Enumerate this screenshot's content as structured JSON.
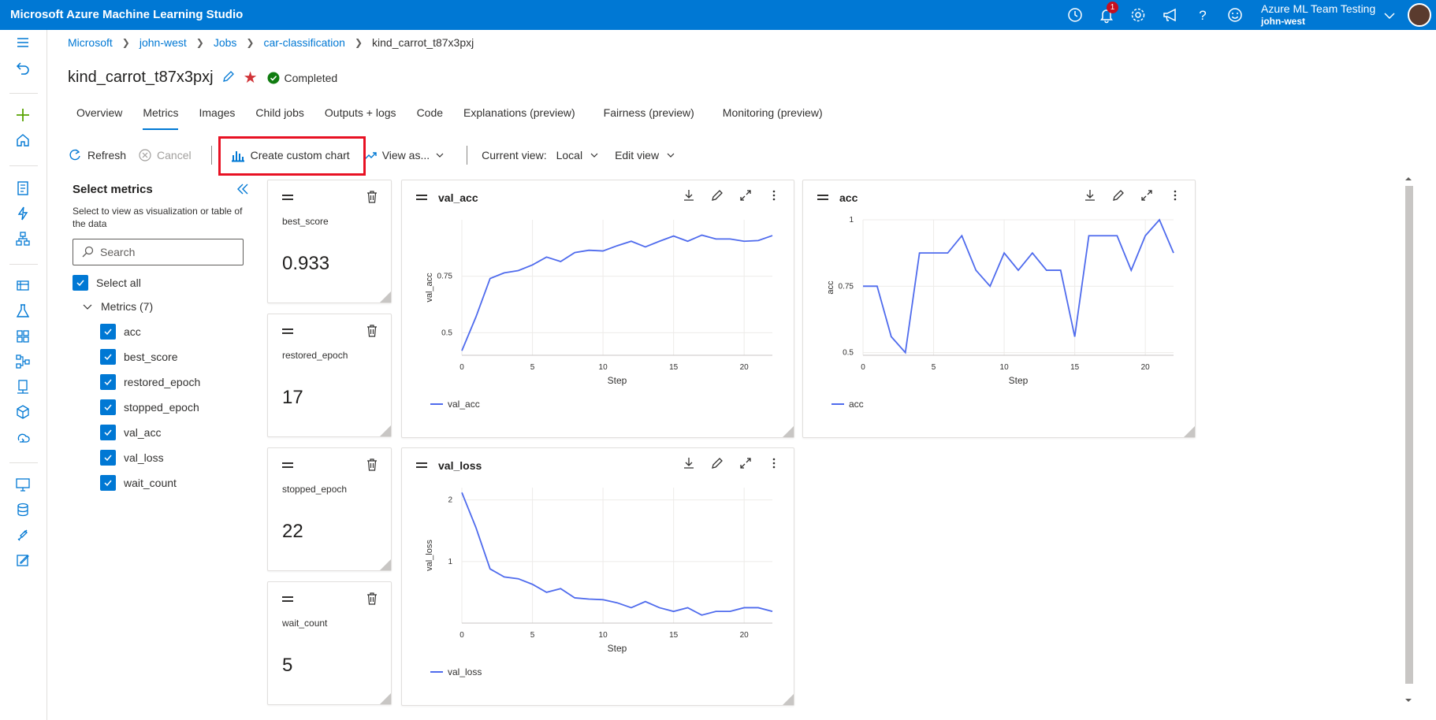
{
  "app": {
    "title": "Microsoft Azure Machine Learning Studio",
    "notification_count": "1",
    "account_name": "Azure ML Team Testing",
    "account_workspace": "john-west",
    "top_icons": [
      "clock-icon",
      "bell-icon",
      "gear-icon",
      "megaphone-icon",
      "help-icon",
      "smiley-icon"
    ]
  },
  "leftnav": {
    "icons": [
      "hamburger-icon",
      "back-icon",
      "plus-icon",
      "home-icon",
      "notebook-icon",
      "automl-icon",
      "designer-icon",
      "data-icon",
      "jobs-icon",
      "components-icon",
      "pipelines-icon",
      "environments-icon",
      "models-icon",
      "endpoints-icon",
      "compute-icon",
      "datastores-icon",
      "linked-services-icon",
      "labeling-icon"
    ]
  },
  "breadcrumb": [
    "Microsoft",
    "john-west",
    "Jobs",
    "car-classification",
    "kind_carrot_t87x3pxj"
  ],
  "run": {
    "name": "kind_carrot_t87x3pxj",
    "status": "Completed"
  },
  "tabs": [
    "Overview",
    "Metrics",
    "Images",
    "Child jobs",
    "Outputs + logs",
    "Code",
    "Explanations (preview)",
    "Fairness (preview)",
    "Monitoring (preview)"
  ],
  "active_tab": "Metrics",
  "toolbar": {
    "refresh": "Refresh",
    "cancel": "Cancel",
    "create_chart": "Create custom chart",
    "view_as": "View as...",
    "current_view_label": "Current view:",
    "current_view_value": "Local",
    "edit_view": "Edit view"
  },
  "panel": {
    "title": "Select metrics",
    "subtitle": "Select to view as visualization or table of the data",
    "search_placeholder": "Search",
    "select_all": "Select all",
    "group": "Metrics (7)",
    "metrics": [
      "acc",
      "best_score",
      "restored_epoch",
      "stopped_epoch",
      "val_acc",
      "val_loss",
      "wait_count"
    ]
  },
  "scalar_cards": [
    {
      "label": "best_score",
      "value": "0.933"
    },
    {
      "label": "restored_epoch",
      "value": "17"
    },
    {
      "label": "stopped_epoch",
      "value": "22"
    },
    {
      "label": "wait_count",
      "value": "5"
    }
  ],
  "colors": {
    "accent": "#0078d4",
    "series": "#4f6bed",
    "success": "#107c10",
    "star": "#d13438",
    "highlight": "#e81123"
  },
  "chart_data": [
    {
      "type": "line",
      "title": "val_acc",
      "xlabel": "Step",
      "ylabel": "val_acc",
      "x": [
        0,
        1,
        2,
        3,
        4,
        5,
        6,
        7,
        8,
        9,
        10,
        11,
        12,
        13,
        14,
        15,
        16,
        17,
        18,
        19,
        20,
        21,
        22
      ],
      "series": [
        {
          "name": "val_acc",
          "values": [
            0.42,
            0.57,
            0.74,
            0.765,
            0.775,
            0.8,
            0.835,
            0.815,
            0.855,
            0.865,
            0.862,
            0.885,
            0.905,
            0.88,
            0.905,
            0.928,
            0.905,
            0.932,
            0.915,
            0.915,
            0.905,
            0.908,
            0.93
          ]
        }
      ],
      "xticks": [
        0,
        5,
        10,
        15,
        20
      ],
      "yticks": [
        0.5,
        0.75
      ],
      "xlim": [
        0,
        22
      ],
      "ylim": [
        0.4,
        1.0
      ]
    },
    {
      "type": "line",
      "title": "acc",
      "xlabel": "Step",
      "ylabel": "acc",
      "x": [
        0,
        1,
        2,
        3,
        4,
        5,
        6,
        7,
        8,
        9,
        10,
        11,
        12,
        13,
        14,
        15,
        16,
        17,
        18,
        19,
        20,
        21,
        22
      ],
      "series": [
        {
          "name": "acc",
          "values": [
            0.75,
            0.75,
            0.56,
            0.5,
            0.875,
            0.875,
            0.875,
            0.94,
            0.81,
            0.75,
            0.875,
            0.81,
            0.875,
            0.81,
            0.81,
            0.56,
            0.94,
            0.94,
            0.94,
            0.81,
            0.94,
            1.0,
            0.875
          ]
        }
      ],
      "xticks": [
        0,
        5,
        10,
        15,
        20
      ],
      "yticks": [
        0.5,
        0.75,
        1
      ],
      "xlim": [
        0,
        22
      ],
      "ylim": [
        0.49,
        1.0
      ]
    },
    {
      "type": "line",
      "title": "val_loss",
      "xlabel": "Step",
      "ylabel": "val_loss",
      "x": [
        0,
        1,
        2,
        3,
        4,
        5,
        6,
        7,
        8,
        9,
        10,
        11,
        12,
        13,
        14,
        15,
        16,
        17,
        18,
        19,
        20,
        21,
        22
      ],
      "series": [
        {
          "name": "val_loss",
          "values": [
            2.12,
            1.55,
            0.88,
            0.75,
            0.72,
            0.63,
            0.5,
            0.56,
            0.41,
            0.39,
            0.38,
            0.33,
            0.25,
            0.35,
            0.25,
            0.19,
            0.25,
            0.13,
            0.19,
            0.19,
            0.25,
            0.25,
            0.19
          ]
        }
      ],
      "xticks": [
        0,
        5,
        10,
        15,
        20
      ],
      "yticks": [
        1,
        2
      ],
      "xlim": [
        0,
        22
      ],
      "ylim": [
        0,
        2.2
      ]
    }
  ]
}
